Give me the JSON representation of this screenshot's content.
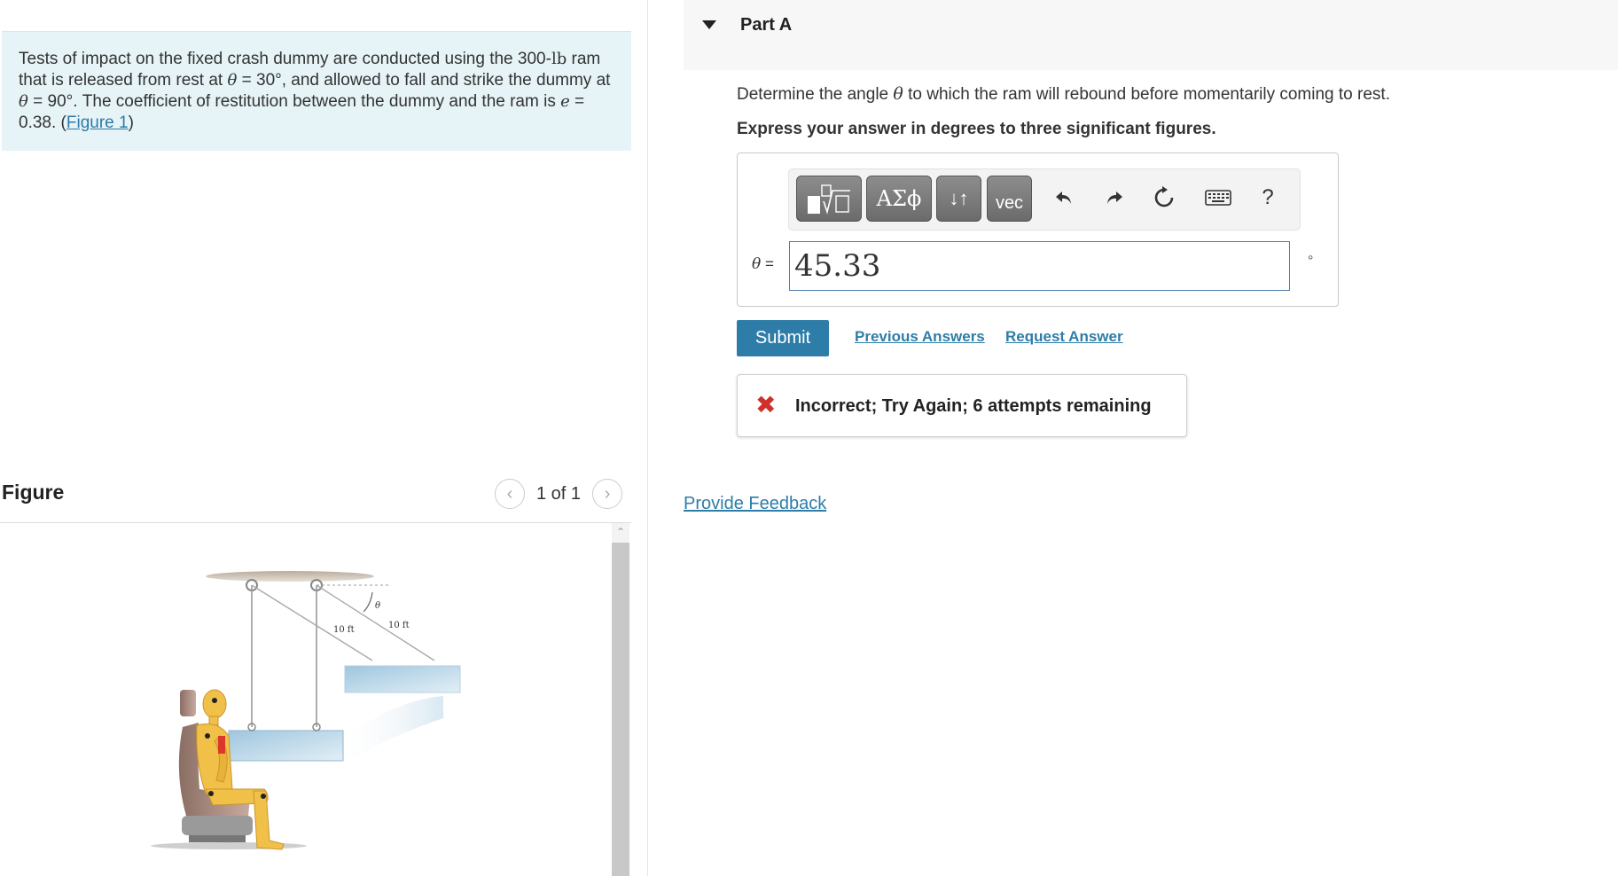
{
  "problem": {
    "text_part1": "Tests of impact on the fixed crash dummy are conducted using the 300-",
    "weight_unit": "lb",
    "text_part2": "ram that is released from rest at ",
    "theta_symbol": "θ",
    "text_part3": " = 30°, and allowed to fall and strike the dummy at ",
    "text_part4": " = 90°. The coefficient of restitution between the dummy and the ram is ",
    "e_symbol": "e",
    "text_part5": " = 0.38. (",
    "figure_link": "Figure 1",
    "text_part6": ")"
  },
  "figure": {
    "title": "Figure",
    "counter": "1 of 1",
    "prev_icon": "chevron-left-icon",
    "next_icon": "chevron-right-icon",
    "label_left": "10 ft",
    "label_right": "10 ft",
    "theta_label": "θ"
  },
  "part": {
    "title": "Part A",
    "question_part1": "Determine the angle ",
    "question_theta": "θ",
    "question_part2": " to which the ram will rebound before momentarily coming to rest.",
    "instruction": "Express your answer in degrees to three significant figures."
  },
  "toolbar": {
    "greek_label": "ΑΣϕ",
    "arrows_label": "↓↑",
    "vec_label": "vec",
    "help_label": "?"
  },
  "answer": {
    "label_theta": "θ",
    "label_equals": " =",
    "value": "45.33",
    "unit": "°"
  },
  "actions": {
    "submit": "Submit",
    "previous_answers": "Previous Answers",
    "request_answer": "Request Answer"
  },
  "feedback": {
    "message": "Incorrect; Try Again; 6 attempts remaining",
    "status_color": "#d0302b"
  },
  "provide_feedback": "Provide Feedback",
  "colors": {
    "accent": "#2e7da8",
    "problem_bg": "#e6f4f7"
  }
}
